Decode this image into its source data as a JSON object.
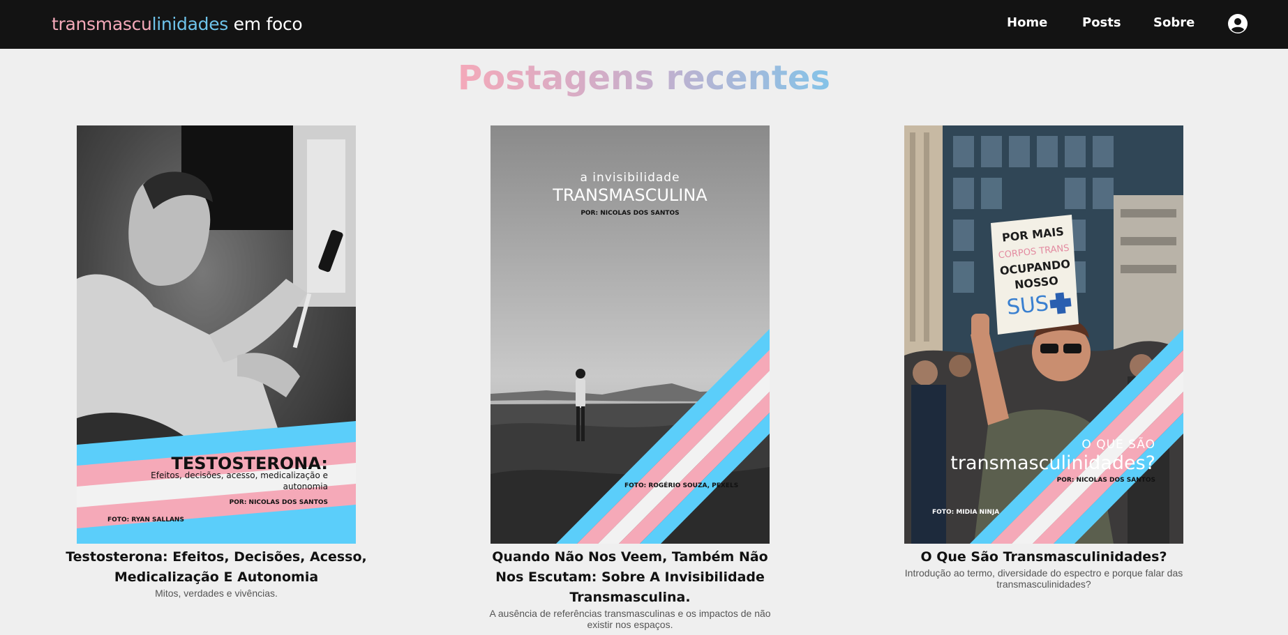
{
  "header": {
    "brand_part1": "transmasculinidades",
    "brand_part1_a": "transmascu",
    "brand_part1_b": "linidades",
    "brand_part2": " em foco",
    "nav": [
      "Home",
      "Posts",
      "Sobre"
    ],
    "account_icon": "user-circle-icon"
  },
  "main": {
    "title": "Postagens recentes",
    "posts": [
      {
        "title": "Testosterona: Efeitos, Decisões, Acesso, Medicalização E Autonomia",
        "description": "Mitos, verdades e vivências.",
        "cover": {
          "heading": "TESTOSTERONA:",
          "subtitle_line1": "Efeitos, decisões, acesso, medicalização e",
          "subtitle_line2": "autonomia",
          "author": "POR: NICOLAS DOS SANTOS",
          "photo_credit": "FOTO: RYAN SALLANS"
        }
      },
      {
        "title": "Quando Não Nos Veem, Também Não Nos Escutam: Sobre A Invisibilidade Transmasculina.",
        "description": "A ausência de referências transmasculinas e os impactos de não existir nos espaços.",
        "cover": {
          "kicker": "a invisibilidade",
          "heading": "TRANSMASCULINA",
          "author": "POR: NICOLAS DOS SANTOS",
          "photo_credit": "FOTO: ROGÉRIO SOUZA, PEXELS"
        }
      },
      {
        "title": "O Que São Transmasculinidades?",
        "description": "Introdução ao termo, diversidade do espectro e porque falar das transmasculinidades?",
        "cover": {
          "kicker": "O QUE SÃO",
          "heading": "transmasculinidades?",
          "author": "POR: NICOLAS DOS SANTOS",
          "photo_credit": "FOTO: MIDIA NINJA",
          "sign_lines": [
            "POR MAIS",
            "CORPOS TRANS",
            "OCUPANDO",
            "NOSSO",
            "SUS"
          ]
        }
      }
    ]
  },
  "colors": {
    "trans_blue": "#5bcefa",
    "trans_pink": "#f5a9b8",
    "trans_white": "#f2f2f2",
    "header_bg": "#131313",
    "page_bg": "#efefef"
  }
}
